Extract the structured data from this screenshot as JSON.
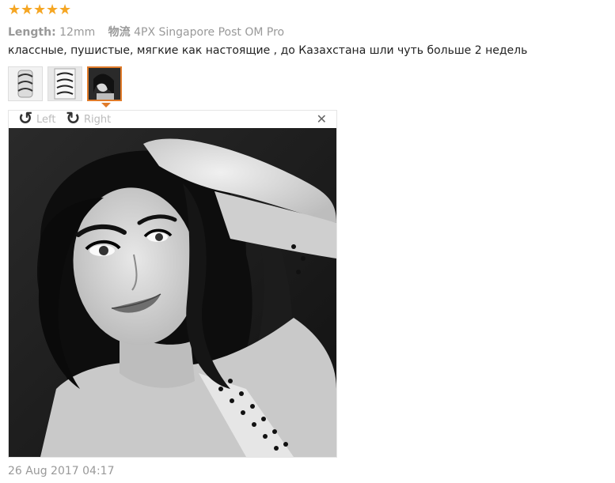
{
  "rating": {
    "stars": 5,
    "star_icon": "star-icon",
    "color": "#f5a623"
  },
  "meta": {
    "length_label": "Length:",
    "length_value": "12mm",
    "logistics_label": "物流",
    "logistics_value": "4PX Singapore Post OM Pro"
  },
  "review": {
    "text": "классные, пушистые, мягкие как настоящие , до Казахстана шли чуть больше 2 недель"
  },
  "thumbnails": {
    "count": 3,
    "active_index": 2,
    "active_color": "#e07b2a"
  },
  "viewer": {
    "rotate_left_label": "Left",
    "rotate_right_label": "Right",
    "rotate_left_icon": "rotate-left-icon",
    "rotate_right_icon": "rotate-right-icon",
    "close_icon": "close-icon"
  },
  "footer": {
    "date": "26 Aug 2017 04:17"
  }
}
